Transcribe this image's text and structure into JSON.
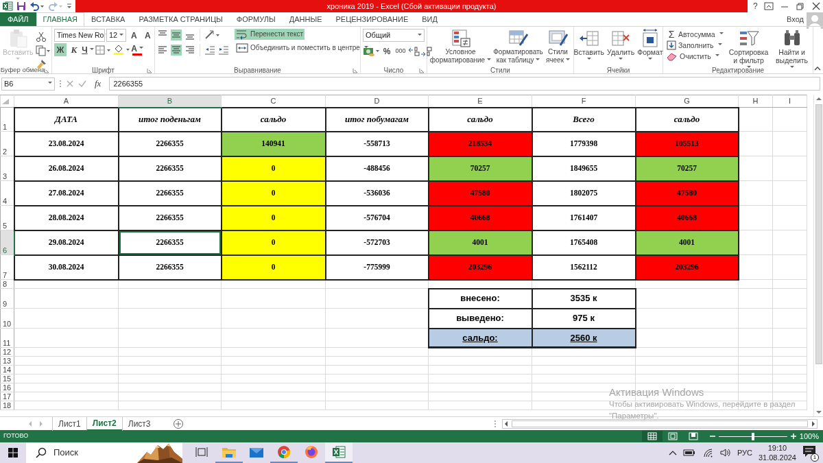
{
  "title_bar": {
    "title": "хроника 2019 -  Excel (Сбой активации продукта)",
    "help": "?",
    "redo_disabled": true
  },
  "ribbon_tabs": [
    {
      "label": "ФАЙЛ",
      "kind": "file",
      "selected": false
    },
    {
      "label": "ГЛАВНАЯ",
      "kind": "tab",
      "selected": true
    },
    {
      "label": "ВСТАВКА",
      "kind": "tab",
      "selected": false
    },
    {
      "label": "РАЗМЕТКА СТРАНИЦЫ",
      "kind": "tab",
      "selected": false
    },
    {
      "label": "ФОРМУЛЫ",
      "kind": "tab",
      "selected": false
    },
    {
      "label": "ДАННЫЕ",
      "kind": "tab",
      "selected": false
    },
    {
      "label": "РЕЦЕНЗИРОВАНИЕ",
      "kind": "tab",
      "selected": false
    },
    {
      "label": "ВИД",
      "kind": "tab",
      "selected": false
    }
  ],
  "account": {
    "sign_in": "Вход"
  },
  "ribbon": {
    "clipboard": {
      "group": "Буфер обмена",
      "paste": "Вставить",
      "paste_disabled": true
    },
    "font": {
      "group": "Шрифт",
      "name": "Times New Ro",
      "size": "12",
      "grow": "A",
      "shrink": "A",
      "bold": "Ж",
      "italic": "К",
      "underline": "Ч",
      "bold_on": true,
      "color_button": "A"
    },
    "alignment": {
      "group": "Выравнивание",
      "middle_on": true,
      "center_on": true,
      "wrap_text": "Перенести текст",
      "wrap_on": true,
      "merge": "Объединить и поместить в центре"
    },
    "number": {
      "group": "Число",
      "format": "Общий",
      "percent": "%",
      "thousands": "000"
    },
    "styles": {
      "group": "Стили",
      "conditional": "Условное форматирование",
      "as_table": "Форматировать как таблицу",
      "cell_styles": "Стили ячеек"
    },
    "cells": {
      "group": "Ячейки",
      "insert": "Вставить",
      "delete": "Удалить",
      "format": "Формат"
    },
    "editing": {
      "group": "Редактирование",
      "autosum_symbol": "Σ",
      "autosum": "Автосумма",
      "fill": "Заполнить",
      "clear": "Очистить",
      "sort": "Сортировка и фильтр",
      "find": "Найти и выделить"
    }
  },
  "formula_bar": {
    "name_box": "B6",
    "fx": "fx",
    "value": "2266355"
  },
  "sheet": {
    "columns": [
      {
        "label": "A",
        "selected": false
      },
      {
        "label": "B",
        "selected": true
      },
      {
        "label": "C",
        "selected": false
      },
      {
        "label": "D",
        "selected": false
      },
      {
        "label": "E",
        "selected": false
      },
      {
        "label": "F",
        "selected": false
      },
      {
        "label": "G",
        "selected": false
      },
      {
        "label": "H",
        "selected": false
      },
      {
        "label": "I",
        "selected": false
      }
    ],
    "rows": [
      {
        "number": "1",
        "kind": "header",
        "selected": false,
        "cells": [
          {
            "text": "ДАТА"
          },
          {
            "text": "итог поденьгам"
          },
          {
            "text": "сальдо"
          },
          {
            "text": "итог побумагам"
          },
          {
            "text": "сальдо"
          },
          {
            "text": "Всего"
          },
          {
            "text": "сальдо"
          }
        ]
      },
      {
        "number": "2",
        "kind": "data",
        "selected": false,
        "cells": [
          {
            "text": "23.08.2024"
          },
          {
            "text": "2266355"
          },
          {
            "text": "140941",
            "color": "#92d050"
          },
          {
            "text": "-558713"
          },
          {
            "text": "218534",
            "color": "#ff0000"
          },
          {
            "text": "1779398"
          },
          {
            "text": "105513",
            "color": "#ff0000"
          }
        ]
      },
      {
        "number": "3",
        "kind": "data",
        "selected": false,
        "cells": [
          {
            "text": "26.08.2024"
          },
          {
            "text": "2266355"
          },
          {
            "text": "0",
            "color": "#ffff00"
          },
          {
            "text": "-488456"
          },
          {
            "text": "70257",
            "color": "#92d050"
          },
          {
            "text": "1849655"
          },
          {
            "text": "70257",
            "color": "#92d050"
          }
        ]
      },
      {
        "number": "4",
        "kind": "data",
        "selected": false,
        "cells": [
          {
            "text": "27.08.2024"
          },
          {
            "text": "2266355"
          },
          {
            "text": "0",
            "color": "#ffff00"
          },
          {
            "text": "-536036"
          },
          {
            "text": "47580",
            "color": "#ff0000"
          },
          {
            "text": "1802075"
          },
          {
            "text": "47580",
            "color": "#ff0000"
          }
        ]
      },
      {
        "number": "5",
        "kind": "data",
        "selected": false,
        "cells": [
          {
            "text": "28.08.2024"
          },
          {
            "text": "2266355"
          },
          {
            "text": "0",
            "color": "#ffff00"
          },
          {
            "text": "-576704"
          },
          {
            "text": "40668",
            "color": "#ff0000"
          },
          {
            "text": "1761407"
          },
          {
            "text": "40668",
            "color": "#ff0000"
          }
        ]
      },
      {
        "number": "6",
        "kind": "data",
        "selected": true,
        "cells": [
          {
            "text": "29.08.2024"
          },
          {
            "text": "2266355"
          },
          {
            "text": "0",
            "color": "#ffff00"
          },
          {
            "text": "-572703"
          },
          {
            "text": "4001",
            "color": "#92d050"
          },
          {
            "text": "1765408"
          },
          {
            "text": "4001",
            "color": "#92d050"
          }
        ]
      },
      {
        "number": "7",
        "kind": "data",
        "selected": false,
        "cells": [
          {
            "text": "30.08.2024"
          },
          {
            "text": "2266355"
          },
          {
            "text": "0",
            "color": "#ffff00"
          },
          {
            "text": "-775999"
          },
          {
            "text": "203296",
            "color": "#ff0000"
          },
          {
            "text": "1562112"
          },
          {
            "text": "203296",
            "color": "#ff0000"
          }
        ]
      },
      {
        "number": "8",
        "kind": "empty",
        "selected": false
      },
      {
        "number": "9",
        "kind": "summary",
        "selected": false,
        "cells": [
          {
            "text": "внесено:"
          },
          {
            "text": "3535 к"
          }
        ]
      },
      {
        "number": "10",
        "kind": "summary",
        "selected": false,
        "cells": [
          {
            "text": "выведено:"
          },
          {
            "text": "975 к"
          }
        ]
      },
      {
        "number": "11",
        "kind": "total",
        "selected": false,
        "cells": [
          {
            "text": "сальдо:",
            "color": "#b8cce4"
          },
          {
            "text": "2560 к",
            "color": "#b8cce4"
          }
        ]
      },
      {
        "number": "12",
        "kind": "empty",
        "selected": false
      },
      {
        "number": "13",
        "kind": "empty",
        "selected": false
      },
      {
        "number": "14",
        "kind": "empty",
        "selected": false
      },
      {
        "number": "15",
        "kind": "empty",
        "selected": false
      },
      {
        "number": "16",
        "kind": "empty",
        "selected": false
      },
      {
        "number": "17",
        "kind": "empty",
        "selected": false
      },
      {
        "number": "18",
        "kind": "empty",
        "selected": false
      }
    ]
  },
  "sheet_tabs": [
    {
      "label": "Лист1",
      "selected": false
    },
    {
      "label": "Лист2",
      "selected": true
    },
    {
      "label": "Лист3",
      "selected": false
    }
  ],
  "status_bar": {
    "status": "ГОТОВО",
    "views": [
      {
        "kind": "normal",
        "selected": true
      },
      {
        "kind": "page_layout",
        "selected": false
      },
      {
        "kind": "page_break",
        "selected": false
      }
    ],
    "zoom_slider": {
      "level": 0.5
    },
    "zoom": "100%"
  },
  "taskbar": {
    "search": {
      "placeholder": "Поиск"
    },
    "apps": [
      {
        "kind": "task_view",
        "running": false,
        "selected": false
      },
      {
        "kind": "explorer",
        "running": true,
        "selected": false
      },
      {
        "kind": "mail",
        "running": false,
        "selected": false
      },
      {
        "kind": "chrome",
        "running": true,
        "selected": false
      },
      {
        "kind": "firefox",
        "running": false,
        "selected": false
      },
      {
        "kind": "excel",
        "running": true,
        "selected": true
      }
    ],
    "language": "РУС",
    "time": "19:10",
    "date": "31.08.2024",
    "notifications": "1"
  },
  "activation_notice": {
    "title": "Активация Windows",
    "text": "Чтобы активировать Windows, перейдите в раздел \"Параметры\"."
  }
}
